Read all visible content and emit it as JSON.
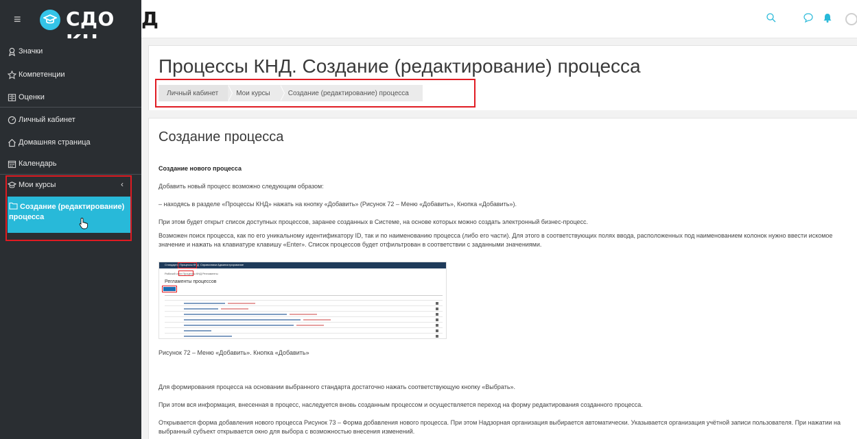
{
  "header": {
    "brand": "СДО КН",
    "brand_tail": "Д",
    "menu_glyph": "≡"
  },
  "sidebar": {
    "items": [
      {
        "label": "Значки",
        "icon": "badge-icon"
      },
      {
        "label": "Компетенции",
        "icon": "star-icon"
      },
      {
        "label": "Оценки",
        "icon": "gradebook-icon"
      },
      {
        "label": "Личный кабинет",
        "icon": "dashboard-icon"
      },
      {
        "label": "Домашняя страница",
        "icon": "home-icon"
      },
      {
        "label": "Календарь",
        "icon": "calendar-icon"
      },
      {
        "label": "Мои курсы",
        "icon": "graduation-cap-icon"
      }
    ],
    "active_item": "Создание (редактирование) процесса",
    "chevron": "‹"
  },
  "page": {
    "title": "Процессы КНД. Создание (редактирование) процесса",
    "breadcrumbs": [
      "Личный кабинет",
      "Мои курсы",
      "Создание (редактирование) процесса"
    ]
  },
  "content": {
    "heading": "Создание процесса",
    "subheading": "Создание нового процесса",
    "p1": "Добавить новый процесс возможно следующим образом:",
    "p2": "–      находясь в разделе «Процессы КНД» нажать на кнопку «Добавить» (Рисунок 72 – Меню «Добавить», Кнопка «Добавить»).",
    "p3": "При этом будет открыт список доступных процессов, заранее созданных в Системе, на основе которых можно создать электронный бизнес-процесс.",
    "p4": "Возможен поиск процесса, как по его уникальному идентификатору ID, так и по наименованию процесса (либо его части). Для этого в соответствующих полях ввода, расположенных под наименованием колонок нужно ввести искомое значение и нажать на клавиатуре клавишу «Enter». Список процессов будет отфильтрован в соответствии с заданными значениями.",
    "caption": "Рисунок 72 – Меню «Добавить». Кнопка «Добавить»",
    "p5": "Для формирования процесса на основании выбранного стандарта достаточно нажать соответствующую кнопку «Выбрать».",
    "p6": "При этом вся информация, внесенная в процесс, наследуется вновь созданным процессом и осуществляется переход на форму редактирования созданного процесса.",
    "p7": "Открывается форма добавления нового процесса Рисунок 73 – Форма добавления нового процесса. При этом Надзорная организация выбирается автоматически. Указывается организация учётной записи пользователя. При нажатии на выбранный субъект открывается окно для выбора с возможностью внесения изменений."
  },
  "figure": {
    "nav_items": [
      "Стандарты",
      "Процессы КНД",
      "Справочники",
      "Администрирование"
    ],
    "tabs": "Рабочий стол   Процессы КНД   Регламенты",
    "title": "Регламенты процессов"
  },
  "colors": {
    "sidebar_bg": "#2a2e32",
    "accent": "#28b9d9",
    "highlight": "#e01b22"
  }
}
